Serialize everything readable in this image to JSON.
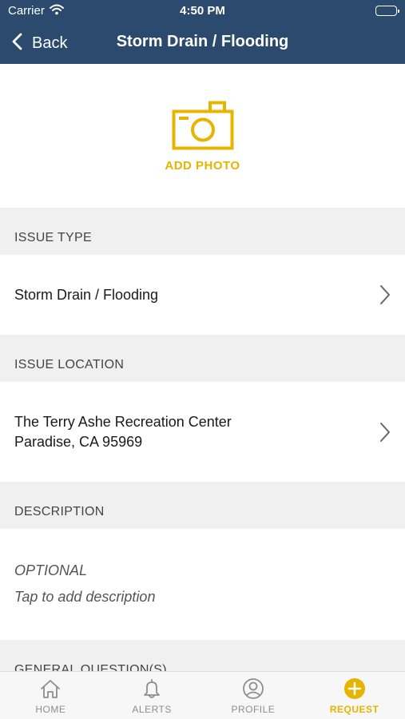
{
  "status_bar": {
    "carrier": "Carrier",
    "time": "4:50 PM"
  },
  "nav": {
    "back_label": "Back",
    "title": "Storm Drain / Flooding"
  },
  "photo": {
    "label": "ADD PHOTO"
  },
  "sections": {
    "issue_type": {
      "header": "ISSUE TYPE",
      "value": "Storm Drain / Flooding"
    },
    "issue_location": {
      "header": "ISSUE LOCATION",
      "line1": "The Terry Ashe Recreation Center",
      "line2": "Paradise, CA 95969"
    },
    "description": {
      "header": "DESCRIPTION",
      "optional": "OPTIONAL",
      "placeholder": "Tap to add description"
    },
    "general_questions": {
      "header": "GENERAL QUESTION(S)"
    }
  },
  "tabs": [
    {
      "label": "HOME",
      "icon": "home-icon",
      "active": false
    },
    {
      "label": "ALERTS",
      "icon": "bell-icon",
      "active": false
    },
    {
      "label": "PROFILE",
      "icon": "profile-icon",
      "active": false
    },
    {
      "label": "REQUEST",
      "icon": "plus-circle-icon",
      "active": true
    }
  ],
  "colors": {
    "nav_bg": "#2c4a6e",
    "accent": "#e8b400",
    "tab_inactive": "#8e8e8e"
  }
}
